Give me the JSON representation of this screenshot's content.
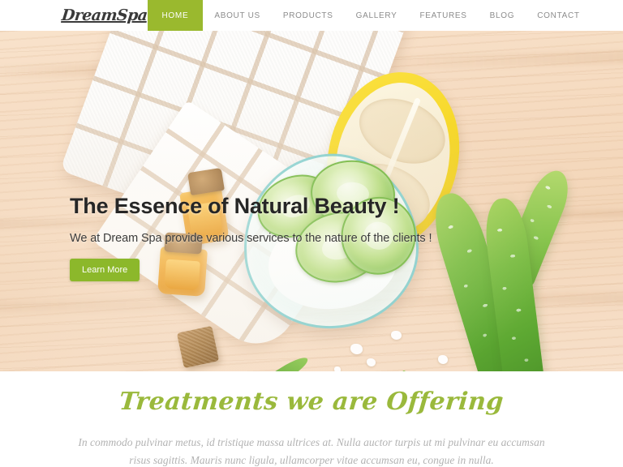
{
  "header": {
    "logo": "DreamSpa",
    "nav": [
      {
        "label": "HOME",
        "active": true
      },
      {
        "label": "ABOUT US",
        "active": false
      },
      {
        "label": "PRODUCTS",
        "active": false
      },
      {
        "label": "GALLERY",
        "active": false
      },
      {
        "label": "FEATURES",
        "active": false
      },
      {
        "label": "BLOG",
        "active": false
      },
      {
        "label": "CONTACT",
        "active": false
      }
    ],
    "active_color": "#9ab92e",
    "nav_text_color": "#8c8c8c",
    "background": "#ffffff"
  },
  "hero": {
    "title": "The Essence of Natural Beauty !",
    "subtitle": "We at Dream Spa provide various services to the nature of the clients !",
    "button_label": "Learn More",
    "button_color": "#8cb82b",
    "title_color": "#262626",
    "scene": {
      "background": "wooden-board",
      "objects": [
        "white-checked-towel",
        "halved-lemon",
        "glass-bowl-with-cucumber-slices",
        "amber-oil-bottles",
        "cork-stopper",
        "aloe-vera-leaves",
        "sea-salt-crystals"
      ]
    }
  },
  "treatments": {
    "title": "Treatments we are Offering",
    "title_color": "#9ab93c",
    "paragraph": "In commodo pulvinar metus, id tristique massa ultrices at. Nulla auctor turpis ut mi pulvinar eu accumsan risus sagittis. Mauris nunc ligula, ullamcorper vitae accumsan eu, congue in nulla."
  }
}
